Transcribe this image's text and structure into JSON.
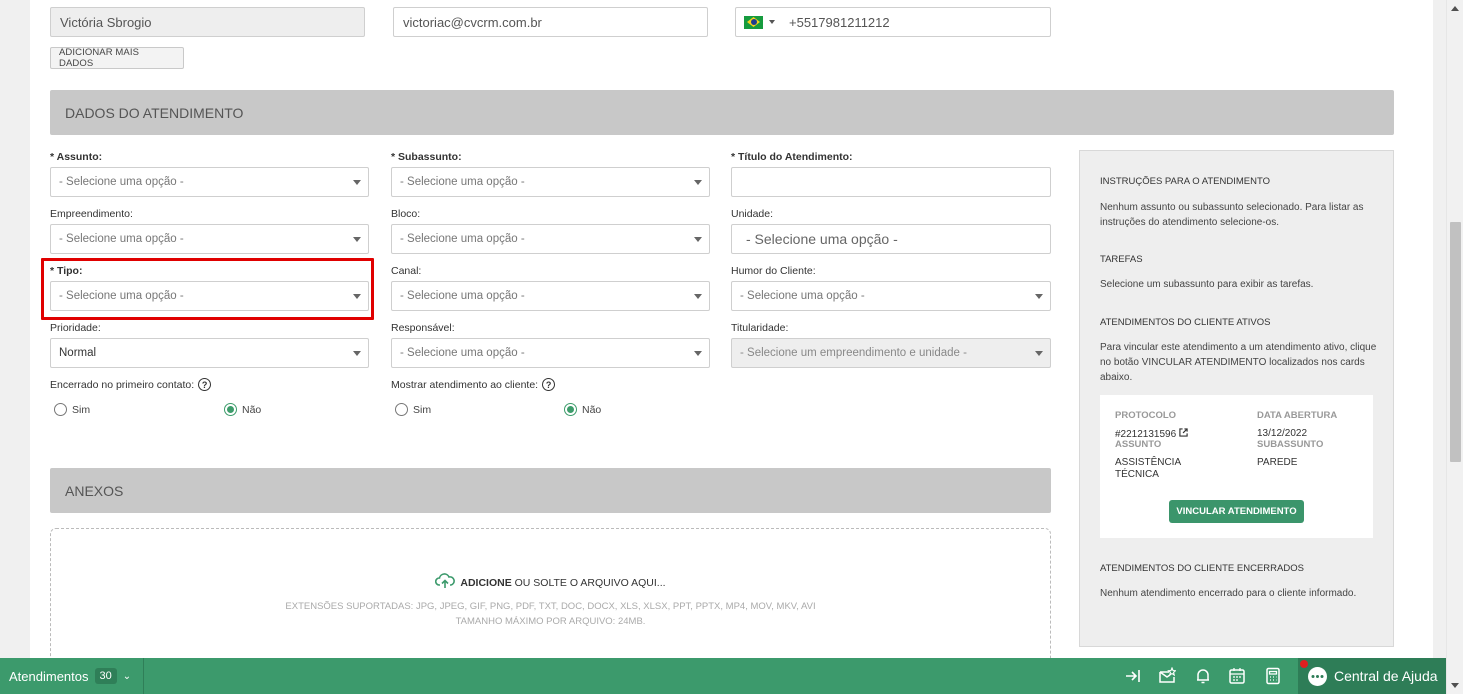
{
  "contact": {
    "name": "Victória Sbrogio",
    "email": "victoriac@cvcrm.com.br",
    "phone": "+5517981211212",
    "add_more_label": "ADICIONAR MAIS DADOS"
  },
  "sections": {
    "atendimento_title": "DADOS DO ATENDIMENTO",
    "anexos_title": "ANEXOS"
  },
  "fields": {
    "assunto": {
      "label": "* Assunto:",
      "value": "- Selecione uma opção -"
    },
    "subassunto": {
      "label": "* Subassunto:",
      "value": "- Selecione uma opção -"
    },
    "titulo": {
      "label": "* Título do Atendimento:",
      "value": ""
    },
    "empreendimento": {
      "label": "Empreendimento:",
      "value": "- Selecione uma opção -"
    },
    "bloco": {
      "label": "Bloco:",
      "value": "- Selecione uma opção -"
    },
    "unidade": {
      "label": "Unidade:",
      "value": "- Selecione uma opção -"
    },
    "tipo": {
      "label": "* Tipo:",
      "value": "- Selecione uma opção -"
    },
    "canal": {
      "label": "Canal:",
      "value": "- Selecione uma opção -"
    },
    "humor": {
      "label": "Humor do Cliente:",
      "value": "- Selecione uma opção -"
    },
    "prioridade": {
      "label": "Prioridade:",
      "value": "Normal"
    },
    "responsavel": {
      "label": "Responsável:",
      "value": "- Selecione uma opção -"
    },
    "titularidade": {
      "label": "Titularidade:",
      "value": "- Selecione um empreendimento e unidade -"
    },
    "encerrado": {
      "label": "Encerrado no primeiro contato:",
      "yes": "Sim",
      "no": "Não",
      "selected": "no"
    },
    "mostrar": {
      "label": "Mostrar atendimento ao cliente:",
      "yes": "Sim",
      "no": "Não",
      "selected": "no"
    }
  },
  "side": {
    "instr_title": "INSTRUÇÕES PARA O ATENDIMENTO",
    "instr_text": "Nenhum assunto ou subassunto selecionado. Para listar as instruções do atendimento selecione-os.",
    "tarefas_title": "TAREFAS",
    "tarefas_text": "Selecione um subassunto para exibir as tarefas.",
    "ativos_title": "ATENDIMENTOS DO CLIENTE ATIVOS",
    "ativos_text": "Para vincular este atendimento a um atendimento ativo, clique no botão VINCULAR ATENDIMENTO localizados nos cards abaixo.",
    "card": {
      "protocolo_label": "PROTOCOLO",
      "protocolo_value": "#2212131596",
      "data_label": "DATA ABERTURA",
      "data_value": "13/12/2022",
      "assunto_label": "ASSUNTO",
      "assunto_value": "ASSISTÊNCIA TÉCNICA",
      "subassunto_label": "SUBASSUNTO",
      "subassunto_value": "PAREDE",
      "button": "VINCULAR ATENDIMENTO"
    },
    "encerrados_title": "ATENDIMENTOS DO CLIENTE ENCERRADOS",
    "encerrados_text": "Nenhum atendimento encerrado para o cliente informado."
  },
  "upload": {
    "action": "ADICIONE",
    "rest": "OU SOLTE O ARQUIVO AQUI...",
    "extensions": "EXTENSÕES SUPORTADAS: JPG, JPEG, GIF, PNG, PDF, TXT, DOC, DOCX, XLS, XLSX, PPT, PPTX, MP4, MOV, MKV, AVI",
    "max_size": "TAMANHO MÁXIMO POR ARQUIVO: 24MB."
  },
  "bottombar": {
    "tab_label": "Atendimentos",
    "tab_count": "30",
    "help_label": "Central de Ajuda"
  },
  "colors": {
    "accent": "#3c9a6c",
    "highlight": "#e00000"
  }
}
